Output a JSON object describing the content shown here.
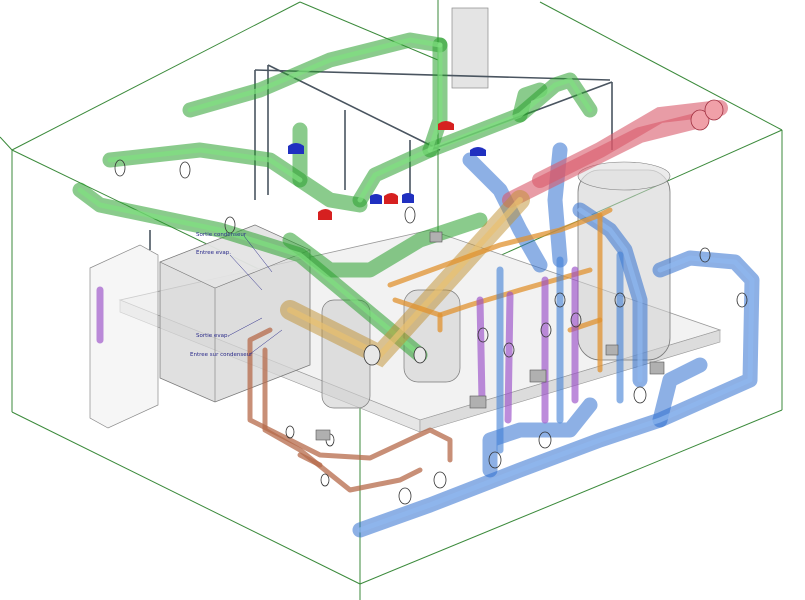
{
  "view": {
    "background": "#ffffff"
  },
  "annotations": [
    {
      "id": "sortie-condenseur",
      "text": "Sortie condenseur"
    },
    {
      "id": "entree-evap",
      "text": "Entree evap."
    },
    {
      "id": "sortie-evap",
      "text": "Sortie evap."
    },
    {
      "id": "entree-condenseur",
      "text": "Entree sur condenseur"
    }
  ],
  "colors": {
    "boundary_box": "#3b8a3b",
    "chilled_water_pipe": "#39c83c",
    "condenser_water_pipe": "#3f7fd6",
    "refrigerant_pipe": "#e0922f",
    "hot_gas_pipe": "#d95a6a",
    "purple_pipe": "#9a4ec8",
    "copper_pipe": "#b56a4a",
    "frame_steel": "#4a5560",
    "valve_red": "#d62020",
    "valve_blue": "#2030c0",
    "equipment_gray": "#c8c8c8"
  }
}
